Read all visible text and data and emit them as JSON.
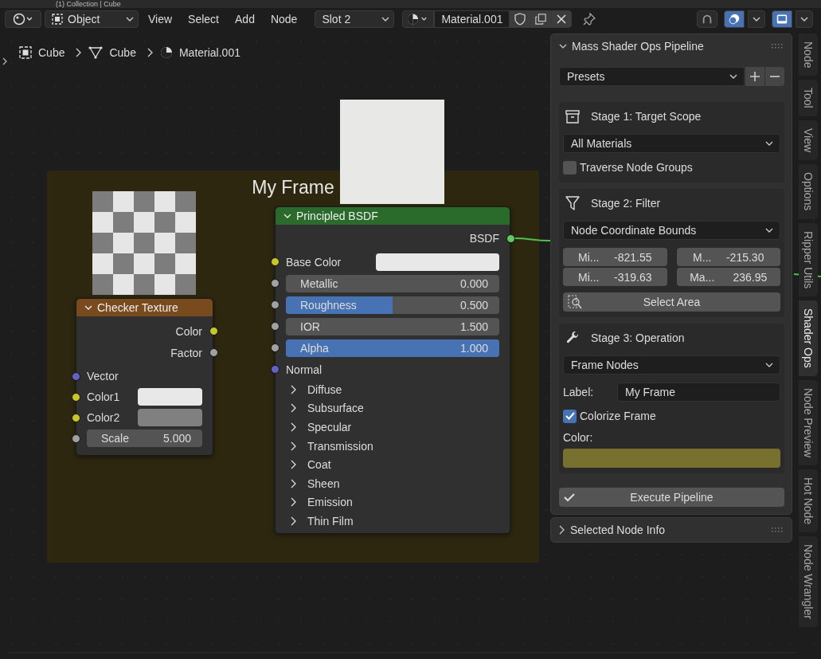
{
  "viewport_header": {
    "text": "(1) Collection | Cube"
  },
  "header": {
    "mode": "Object",
    "menus": [
      "View",
      "Select",
      "Add",
      "Node"
    ],
    "slot": "Slot 2",
    "material": "Material.001"
  },
  "breadcrumb": [
    {
      "kind": "object",
      "label": "Cube"
    },
    {
      "kind": "mesh",
      "label": "Cube"
    },
    {
      "kind": "material",
      "label": "Material.001"
    }
  ],
  "frame": {
    "label": "My Frame"
  },
  "checker_node": {
    "title": "Checker Texture",
    "expanded": true,
    "outputs": [
      {
        "name": "Color",
        "color": "#c7c729"
      },
      {
        "name": "Factor",
        "color": "#a1a1a1"
      }
    ],
    "inputs": [
      {
        "kind": "plain",
        "name": "Vector",
        "color": "#6363c7"
      },
      {
        "kind": "swatch",
        "name": "Color1",
        "color": "#c7c729",
        "swatch": {
          "color": "#e8e8e8"
        }
      },
      {
        "kind": "swatch",
        "name": "Color2",
        "color": "#c7c729",
        "swatch": {
          "color": "#808080"
        }
      },
      {
        "kind": "number",
        "name": "Scale",
        "color": "#a1a1a1",
        "value": "5.000"
      }
    ]
  },
  "bsdf_node": {
    "title": "Principled BSDF",
    "expanded": true,
    "output": {
      "name": "BSDF",
      "color": "#63c763"
    },
    "inputs": [
      {
        "kind": "swatch",
        "name": "Base Color",
        "color": "#c7c729",
        "swatch": {
          "color": "#e8e8e8"
        }
      },
      {
        "kind": "number",
        "name": "Metallic",
        "color": "#a1a1a1",
        "value": "0.000"
      },
      {
        "kind": "slider",
        "name": "Roughness",
        "color": "#a1a1a1",
        "value": "0.500",
        "level": 0.5
      },
      {
        "kind": "number",
        "name": "IOR",
        "color": "#a1a1a1",
        "value": "1.500"
      },
      {
        "kind": "slider",
        "name": "Alpha",
        "color": "#a1a1a1",
        "value": "1.000",
        "level": 1
      },
      {
        "kind": "plain",
        "name": "Normal",
        "color": "#6363c7"
      }
    ],
    "panels": [
      {
        "label": "Diffuse",
        "expanded": false
      },
      {
        "label": "Subsurface",
        "expanded": false
      },
      {
        "label": "Specular",
        "expanded": false
      },
      {
        "label": "Transmission",
        "expanded": false
      },
      {
        "label": "Coat",
        "expanded": false
      },
      {
        "label": "Sheen",
        "expanded": false
      },
      {
        "label": "Emission",
        "expanded": false
      },
      {
        "label": "Thin Film",
        "expanded": false
      }
    ]
  },
  "sidebar": {
    "title": "Mass Shader Ops Pipeline",
    "expanded": true,
    "presets": "Presets",
    "stage1": {
      "title": "Stage 1: Target Scope",
      "dropdown": "All Materials",
      "checkbox": {
        "label": "Traverse Node Groups",
        "checked": false
      }
    },
    "stage2": {
      "title": "Stage 2: Filter",
      "dropdown": "Node Coordinate Bounds",
      "bounds": [
        {
          "label": "Mi...",
          "value": "-821.55"
        },
        {
          "label": "M...",
          "value": "-215.30"
        },
        {
          "label": "Mi...",
          "value": "-319.63"
        },
        {
          "label": "Ma...",
          "value": "236.95"
        }
      ],
      "button": "Select Area"
    },
    "stage3": {
      "title": "Stage 3: Operation",
      "dropdown": "Frame Nodes",
      "field_label": "Label:",
      "field_value": "My Frame",
      "checkbox": {
        "label": "Colorize Frame",
        "checked": true
      },
      "color_label": "Color:",
      "color": "#77702f"
    },
    "execute": "Execute Pipeline"
  },
  "info_panel": {
    "title": "Selected Node Info",
    "expanded": false
  },
  "tabs": [
    {
      "label": "Node",
      "selected": false
    },
    {
      "label": "Tool",
      "selected": false
    },
    {
      "label": "View",
      "selected": false
    },
    {
      "label": "Options",
      "selected": false
    },
    {
      "label": "Ripper Utils",
      "selected": false
    },
    {
      "label": "Shader Ops",
      "selected": true
    },
    {
      "label": "Node Preview",
      "selected": false
    },
    {
      "label": "Hot Node",
      "selected": false
    },
    {
      "label": "Node Wrangler",
      "selected": false
    }
  ]
}
